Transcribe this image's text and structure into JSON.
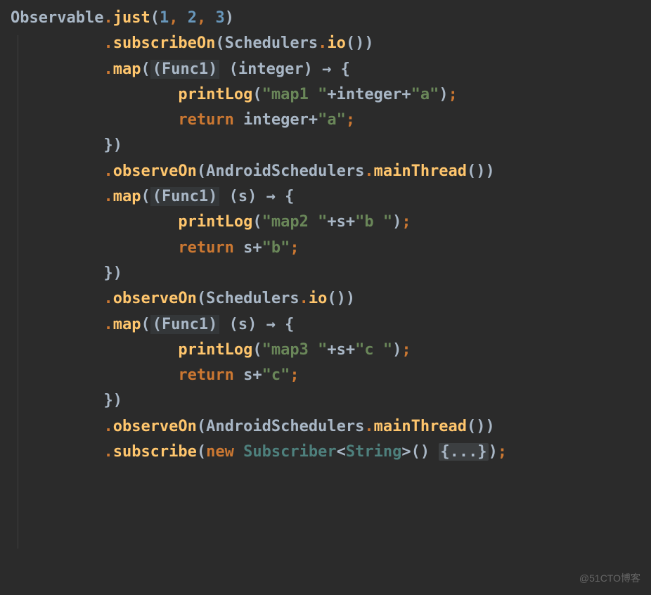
{
  "code": {
    "l1": {
      "t1": "Observable",
      "t2": ".",
      "t3": "just",
      "t4": "(",
      "t5": "1",
      "t6": ", ",
      "t7": "2",
      "t8": ", ",
      "t9": "3",
      "t10": ")"
    },
    "l2": {
      "t1": "          ",
      "t2": ".",
      "t3": "subscribeOn",
      "t4": "(",
      "t5": "Schedulers",
      "t6": ".",
      "t7": "io",
      "t8": "())"
    },
    "l3": {
      "t1": "          ",
      "t2": ".",
      "t3": "map",
      "t4": "(",
      "t5": "(Func1)",
      "t6": " (integer) ",
      "t7": "→",
      "t8": " {"
    },
    "l4": {
      "t1": "                  ",
      "t2": "printLog",
      "t3": "(",
      "t4": "\"map1 \"",
      "t5": "+",
      "t6": "integer",
      "t7": "+",
      "t8": "\"a\"",
      "t9": ")",
      "t10": ";"
    },
    "l5": {
      "t1": "                  ",
      "t2": "return ",
      "t3": "integer",
      "t4": "+",
      "t5": "\"a\"",
      "t6": ";"
    },
    "l6": {
      "t1": "          })"
    },
    "l7": {
      "t1": "          ",
      "t2": ".",
      "t3": "observeOn",
      "t4": "(",
      "t5": "AndroidSchedulers",
      "t6": ".",
      "t7": "mainThread",
      "t8": "())"
    },
    "l8": {
      "t1": "          ",
      "t2": ".",
      "t3": "map",
      "t4": "(",
      "t5": "(Func1)",
      "t6": " (s) ",
      "t7": "→",
      "t8": " {"
    },
    "l9": {
      "t1": "                  ",
      "t2": "printLog",
      "t3": "(",
      "t4": "\"map2 \"",
      "t5": "+",
      "t6": "s",
      "t7": "+",
      "t8": "\"b \"",
      "t9": ")",
      "t10": ";"
    },
    "l10": {
      "t1": "                  ",
      "t2": "return ",
      "t3": "s",
      "t4": "+",
      "t5": "\"b\"",
      "t6": ";"
    },
    "l11": {
      "t1": "          })"
    },
    "l12": {
      "t1": "          ",
      "t2": ".",
      "t3": "observeOn",
      "t4": "(",
      "t5": "Schedulers",
      "t6": ".",
      "t7": "io",
      "t8": "())"
    },
    "l13": {
      "t1": "          ",
      "t2": ".",
      "t3": "map",
      "t4": "(",
      "t5": "(Func1)",
      "t6": " (s) ",
      "t7": "→",
      "t8": " {"
    },
    "l14": {
      "t1": "                  ",
      "t2": "printLog",
      "t3": "(",
      "t4": "\"map3 \"",
      "t5": "+",
      "t6": "s",
      "t7": "+",
      "t8": "\"c \"",
      "t9": ")",
      "t10": ";"
    },
    "l15": {
      "t1": "                  ",
      "t2": "return ",
      "t3": "s",
      "t4": "+",
      "t5": "\"c\"",
      "t6": ";"
    },
    "l16": {
      "t1": "          })"
    },
    "l17": {
      "t1": "          ",
      "t2": ".",
      "t3": "observeOn",
      "t4": "(",
      "t5": "AndroidSchedulers",
      "t6": ".",
      "t7": "mainThread",
      "t8": "())"
    },
    "l18": {
      "t1": "          ",
      "t2": ".",
      "t3": "subscribe",
      "t4": "(",
      "t5": "new ",
      "t6": "Subscriber",
      "t7": "<",
      "t8": "String",
      "t9": ">() ",
      "t10": "{...}",
      "t11": ")",
      "t12": ";"
    }
  },
  "watermark": "@51CTO博客"
}
